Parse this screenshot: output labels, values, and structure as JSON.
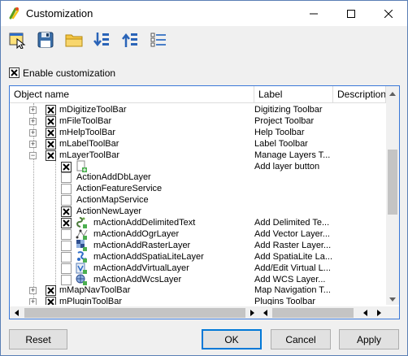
{
  "window": {
    "title": "Customization"
  },
  "window_controls": {
    "minimize_icon": "minimize-icon",
    "maximize_icon": "maximize-icon",
    "close_icon": "close-icon"
  },
  "toolbar": {
    "icons": [
      "select-widget-icon",
      "save-icon",
      "open-folder-icon",
      "expand-all-icon",
      "collapse-all-icon",
      "check-list-icon"
    ]
  },
  "enable_customization": {
    "label": "Enable customization",
    "checked": true
  },
  "tree": {
    "columns": [
      "Object name",
      "Label",
      "Description"
    ],
    "rows": [
      {
        "name": "mDigitizeToolBar",
        "label": "Digitizing Toolbar",
        "checked": true,
        "expandable": true,
        "expanded": false
      },
      {
        "name": "mFileToolBar",
        "label": "Project Toolbar",
        "checked": true,
        "expandable": true,
        "expanded": false
      },
      {
        "name": "mHelpToolBar",
        "label": "Help Toolbar",
        "checked": true,
        "expandable": true,
        "expanded": false
      },
      {
        "name": "mLabelToolBar",
        "label": "Label Toolbar",
        "checked": true,
        "expandable": true,
        "expanded": false
      },
      {
        "name": "mLayerToolBar",
        "label": "Manage Layers T...",
        "checked": true,
        "expandable": true,
        "expanded": true
      },
      {
        "name": "",
        "label": "Add layer button",
        "checked": true,
        "icon": "add-layer-icon"
      },
      {
        "name": "ActionAddDbLayer",
        "label": "",
        "checked": false
      },
      {
        "name": "ActionFeatureService",
        "label": "",
        "checked": false
      },
      {
        "name": "ActionMapService",
        "label": "",
        "checked": false
      },
      {
        "name": "ActionNewLayer",
        "label": "",
        "checked": true
      },
      {
        "name": "mActionAddDelimitedText",
        "label": "Add Delimited Te...",
        "checked": true,
        "icon": "delimited-text-icon"
      },
      {
        "name": "mActionAddOgrLayer",
        "label": "Add Vector Layer...",
        "checked": false,
        "icon": "vector-layer-icon"
      },
      {
        "name": "mActionAddRasterLayer",
        "label": "Add Raster Layer...",
        "checked": false,
        "icon": "raster-layer-icon"
      },
      {
        "name": "mActionAddSpatiaLiteLayer",
        "label": "Add SpatiaLite La...",
        "checked": false,
        "icon": "spatialite-layer-icon"
      },
      {
        "name": "mActionAddVirtualLayer",
        "label": "Add/Edit Virtual L...",
        "checked": false,
        "icon": "virtual-layer-icon"
      },
      {
        "name": "mActionAddWcsLayer",
        "label": "Add WCS Layer...",
        "checked": false,
        "icon": "wcs-layer-icon"
      },
      {
        "name": "mMapNavToolBar",
        "label": "Map Navigation T...",
        "checked": true,
        "expandable": true,
        "expanded": false
      },
      {
        "name": "mPluginToolBar",
        "label": "Plugins Toolbar",
        "checked": true,
        "expandable": true,
        "expanded": false
      }
    ]
  },
  "buttons": {
    "reset": "Reset",
    "ok": "OK",
    "cancel": "Cancel",
    "apply": "Apply"
  },
  "colors": {
    "accent": "#0078d7",
    "focus_border": "#3a78d8"
  }
}
